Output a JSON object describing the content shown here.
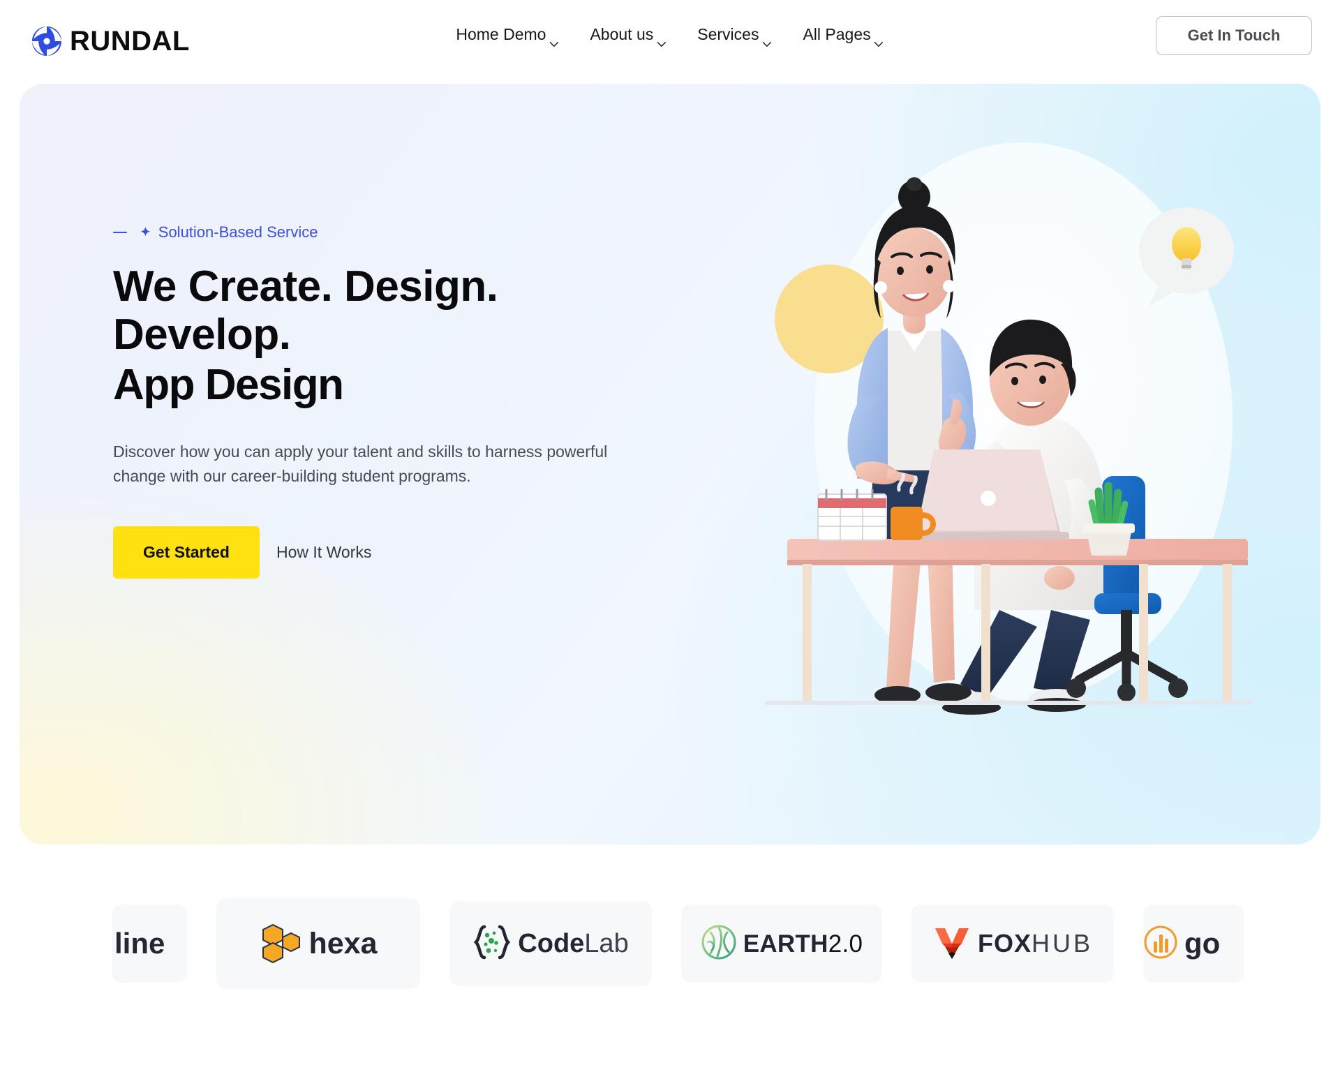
{
  "header": {
    "brand": {
      "name": "RUNDAL",
      "icon": "rundal-swirl-logo-icon",
      "color": "#2d4ce0"
    },
    "nav": [
      {
        "label": "Home Demo",
        "has_dropdown": true
      },
      {
        "label": "About us",
        "has_dropdown": true
      },
      {
        "label": "Services",
        "has_dropdown": true
      },
      {
        "label": "All Pages",
        "has_dropdown": true
      }
    ],
    "cta": {
      "label": "Get In Touch"
    }
  },
  "hero": {
    "eyebrow": {
      "text": "Solution-Based Service",
      "star": "✦",
      "color": "#3d4fdc"
    },
    "headline": {
      "line1": "We Create. Design.",
      "line2": "Develop.",
      "line3": "App Design"
    },
    "description": "Discover how you can apply your talent and skills to harness powerful change with our career-building student programs.",
    "primary_button": {
      "label": "Get Started",
      "color": "#ffe011"
    },
    "secondary_link": {
      "label": "How It Works"
    },
    "illustration": {
      "name": "team-collaboration-3d-illustration",
      "alt": "Woman standing pointing at a laptop while a seated man works, with an idea light bulb speech bubble",
      "accent_circle_color": "#fade8f",
      "chair_color": "#1565c0",
      "desk_color": "#f0b7ad"
    }
  },
  "logos": {
    "items": [
      {
        "name": "line-partial",
        "text": "line",
        "clipped": true
      },
      {
        "name": "hexa",
        "text": "hexa",
        "icon": "hexagon-cluster-icon",
        "icon_color": "#f5a726"
      },
      {
        "name": "codelab",
        "text": "Code",
        "text_light": "Lab",
        "icon": "curly-braces-dots-icon",
        "icon_color": "#2ea44f"
      },
      {
        "name": "earth-2-0",
        "text": "EARTH",
        "text_light": "2.0",
        "icon": "globe-icon",
        "icon_color": "#4cae6a"
      },
      {
        "name": "fox-hub",
        "text": "FOX",
        "text_light": "HUB",
        "icon": "fox-head-icon",
        "icon_color": "#e8381f"
      },
      {
        "name": "go",
        "text": "go",
        "icon": "circle-bars-icon",
        "icon_color": "#f29b2a"
      }
    ]
  }
}
